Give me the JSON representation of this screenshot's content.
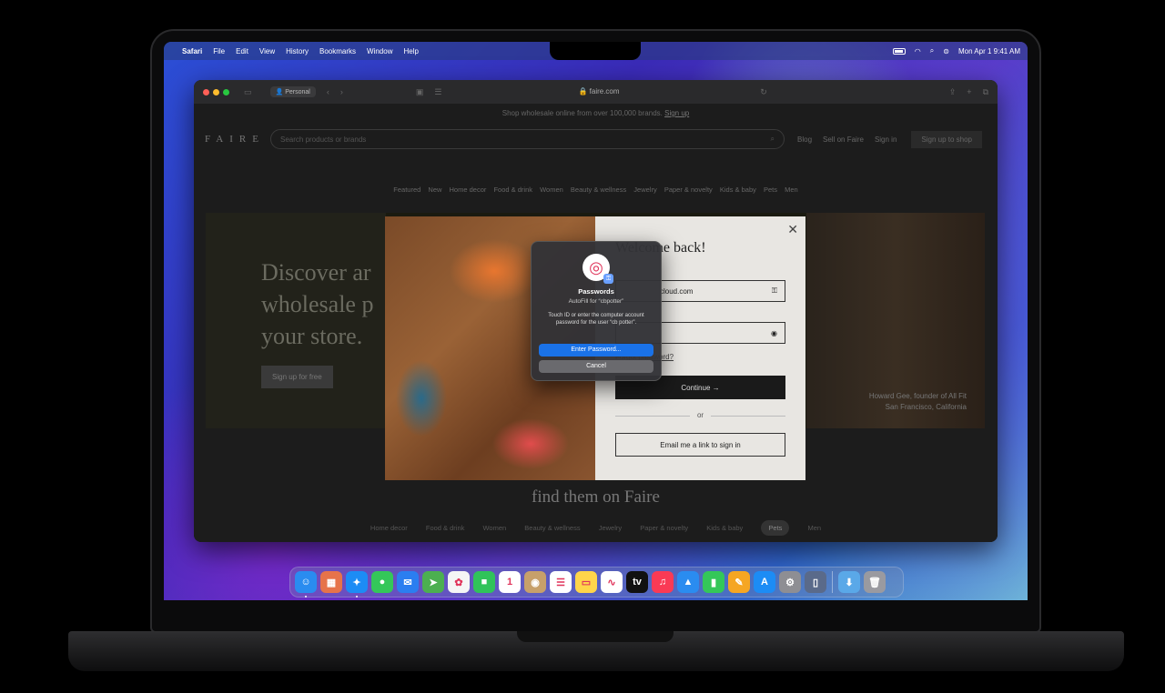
{
  "menubar": {
    "apple_icon": "apple-icon",
    "app_name": "Safari",
    "menus": [
      "File",
      "Edit",
      "View",
      "History",
      "Bookmarks",
      "Window",
      "Help"
    ],
    "clock": "Mon Apr 1  9:41 AM"
  },
  "browser": {
    "profile": "Personal",
    "url": "faire.com"
  },
  "faire": {
    "promo_text": "Shop wholesale online from over 100,000 brands.",
    "promo_link": "Sign up",
    "logo": "FAIRE",
    "search_placeholder": "Search products or brands",
    "header_links": [
      "Blog",
      "Sell on Faire",
      "Sign in"
    ],
    "signup_button": "Sign up to shop",
    "categories": [
      "Featured",
      "New",
      "Home decor",
      "Food & drink",
      "Women",
      "Beauty & wellness",
      "Jewelry",
      "Paper & novelty",
      "Kids & baby",
      "Pets",
      "Men"
    ],
    "hero_title_lines": [
      "Discover ar",
      "wholesale p",
      "your store."
    ],
    "hero_button": "Sign up for free",
    "hero_caption_lines": [
      "Howard Gee, founder of All Fit",
      "San Francisco, California"
    ],
    "find_text": "find them on Faire",
    "bottom_categories": [
      "Home decor",
      "Food & drink",
      "Women",
      "Beauty & wellness",
      "Jewelry",
      "Paper & novelty",
      "Kids & baby",
      "Pets",
      "Men"
    ],
    "bottom_active": "Pets"
  },
  "signin_modal": {
    "title": "Welcome back!",
    "email_value": "cloud.com",
    "forgot_link": "Forgot password?",
    "continue_button": "Continue →",
    "or_text": "or",
    "email_link_button": "Email me a link to sign in"
  },
  "password_dialog": {
    "title": "Passwords",
    "subtitle": "AutoFill for “cbpotter”",
    "message": "Touch ID or enter the computer account password for the user “cb potter”.",
    "enter_button": "Enter Password...",
    "cancel_button": "Cancel"
  },
  "dock": {
    "apps": [
      {
        "name": "finder",
        "glyph": "☺",
        "color": "#2a8cf0",
        "running": true
      },
      {
        "name": "launchpad",
        "glyph": "▦",
        "color": "#e6734a",
        "running": false
      },
      {
        "name": "safari",
        "glyph": "✦",
        "color": "#1c8cf5",
        "running": true
      },
      {
        "name": "messages",
        "glyph": "●",
        "color": "#34c759",
        "running": false
      },
      {
        "name": "mail",
        "glyph": "✉",
        "color": "#2b7ef0",
        "running": false
      },
      {
        "name": "maps",
        "glyph": "➤",
        "color": "#4caf50",
        "running": false
      },
      {
        "name": "photos",
        "glyph": "✿",
        "color": "#f5f5f5",
        "running": false
      },
      {
        "name": "facetime",
        "glyph": "■",
        "color": "#30c35a",
        "running": false
      },
      {
        "name": "calendar",
        "glyph": "1",
        "color": "#ffffff",
        "running": false
      },
      {
        "name": "contacts",
        "glyph": "◉",
        "color": "#c7a06a",
        "running": false
      },
      {
        "name": "reminders",
        "glyph": "☰",
        "color": "#ffffff",
        "running": false
      },
      {
        "name": "notes",
        "glyph": "▭",
        "color": "#ffd54a",
        "running": false
      },
      {
        "name": "freeform",
        "glyph": "∿",
        "color": "#ffffff",
        "running": false
      },
      {
        "name": "tv",
        "glyph": "tv",
        "color": "#111111",
        "running": false
      },
      {
        "name": "music",
        "glyph": "♫",
        "color": "#fa3a55",
        "running": false
      },
      {
        "name": "keynote",
        "glyph": "▲",
        "color": "#2a8cf0",
        "running": false
      },
      {
        "name": "numbers",
        "glyph": "▮",
        "color": "#34c759",
        "running": false
      },
      {
        "name": "pages",
        "glyph": "✎",
        "color": "#f5a623",
        "running": false
      },
      {
        "name": "app-store",
        "glyph": "A",
        "color": "#1c8cf5",
        "running": false
      },
      {
        "name": "system-settings",
        "glyph": "⚙",
        "color": "#8e8e93",
        "running": false
      },
      {
        "name": "iphone-mirroring",
        "glyph": "▯",
        "color": "#5a6a8a",
        "running": false
      }
    ],
    "trailing": [
      {
        "name": "downloads",
        "glyph": "⬇",
        "color": "#5aa8e8",
        "running": false
      },
      {
        "name": "trash",
        "glyph": "🗑",
        "color": "#9a9aa0",
        "running": false
      }
    ]
  }
}
